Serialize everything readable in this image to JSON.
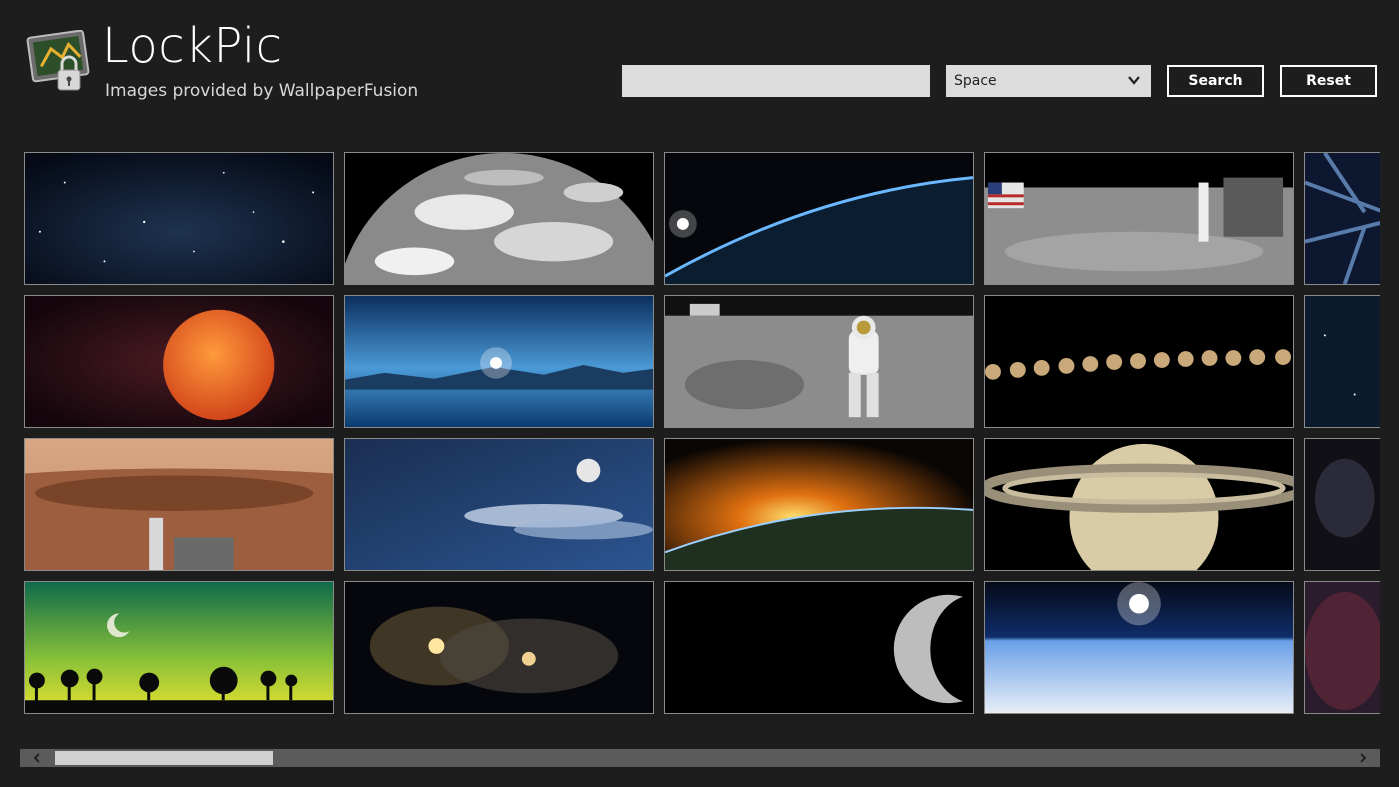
{
  "header": {
    "title": "LockPic",
    "subtitle": "Images provided by WallpaperFusion",
    "logo_icon": "lockpic-logo-icon"
  },
  "search": {
    "value": "",
    "placeholder": ""
  },
  "category": {
    "selected": "Space",
    "icon": "chevron-down-icon"
  },
  "buttons": {
    "search_label": "Search",
    "reset_label": "Reset"
  },
  "gallery": {
    "rows": 4,
    "visible_columns": 5,
    "tiles": [
      "starfield-nebula",
      "earth-black-white",
      "earth-horizon-flare",
      "moon-landing-flag",
      "blue-warp",
      "red-planet",
      "icy-planet-lake",
      "astronaut-moon",
      "moon-phases",
      "deep-space-blue",
      "mars-crater",
      "moon-clouds-night",
      "sunrise-over-planet",
      "saturn-rings",
      "dark-nebula",
      "green-moon-palms",
      "spiral-galaxies",
      "moon-crescent-dark",
      "earth-sun-horizon",
      "red-nebula"
    ]
  },
  "colors": {
    "background": "#1d1d1d",
    "input": "#dcdcdc",
    "scroll_track": "#5b5b5b",
    "scroll_thumb": "#d0d0d0"
  },
  "scroll": {
    "position_fraction": 0.0,
    "thumb_fraction": 0.17
  }
}
